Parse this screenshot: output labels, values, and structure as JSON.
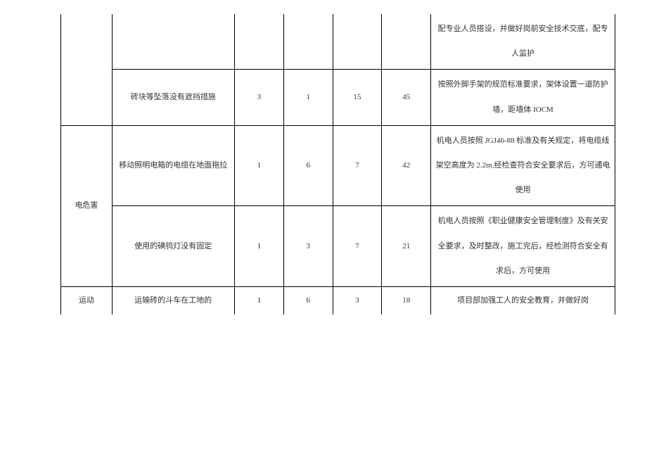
{
  "rows": {
    "r1": {
      "cat": "",
      "desc": "",
      "v1": "",
      "v2": "",
      "v3": "",
      "v4": "",
      "measure": "配专业人员搭设，并做好岗前安全技术交底，配专人监护"
    },
    "r2": {
      "desc": "砖块等坠落没有遮挡措施",
      "v1": "3",
      "v2": "1",
      "v3": "15",
      "v4": "45",
      "measure": "按照外脚手架的规范标准要求，架体设置一道防护墙，距墙体 IOCM"
    },
    "r3": {
      "cat": "电危害",
      "desc": "移动照明电箱的电缆在地面拖拉",
      "v1": "1",
      "v2": "6",
      "v3": "7",
      "v4": "42",
      "measure": "机电人员按照 JGJ46-88 标准及有关规定，将电缆线架空高度为 2.2m,经检查符合安全要求后，方可通电使用"
    },
    "r4": {
      "desc": "使用的碘钨灯没有固定",
      "v1": "1",
      "v2": "3",
      "v3": "7",
      "v4": "21",
      "measure": "机电人员按照《职业健康安全管理制度》及有关安全要求，及时整改，施工完后，经检测符合安全有求后，方可使用"
    },
    "r5": {
      "cat": "运动",
      "desc": "运输砖的斗车在工地的",
      "v1": "1",
      "v2": "6",
      "v3": "3",
      "v4": "18",
      "measure": "项目部加强工人的安全教育，并做好岗"
    }
  }
}
